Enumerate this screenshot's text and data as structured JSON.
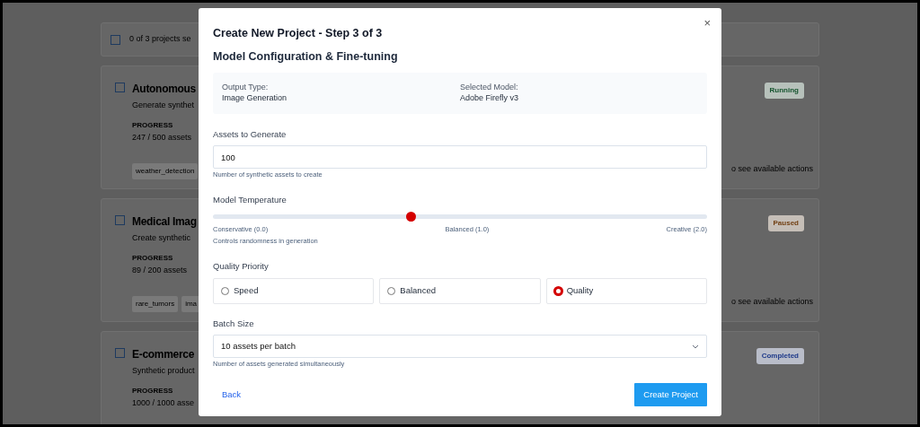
{
  "background": {
    "selection_bar": {
      "checked": false,
      "text": "0 of 3 projects se"
    },
    "projects": [
      {
        "checked": false,
        "title": "Autonomous",
        "description": "Generate synthet",
        "progress_label": "PROGRESS",
        "progress": "247 / 500 assets",
        "tags": [
          "weather_detection"
        ],
        "status": "Running",
        "color": "#14532d",
        "actions_hint": "o see available actions"
      },
      {
        "checked": false,
        "title": "Medical Imag",
        "description": "Create synthetic",
        "progress_label": "PROGRESS",
        "progress": "89 / 200 assets",
        "tags": [
          "rare_tumors",
          "ima"
        ],
        "status": "Paused",
        "color": "#713f12",
        "actions_hint": "o see available actions"
      },
      {
        "checked": false,
        "title": "E-commerce",
        "description": "Synthetic product",
        "progress_label": "PROGRESS",
        "progress": "1000 / 1000 asse",
        "status": "Completed",
        "color": "#1e3a8a"
      }
    ]
  },
  "modal": {
    "title": "Create New Project - Step 3 of 3",
    "close": "×",
    "subtitle": "Model Configuration & Fine-tuning",
    "summary": [
      {
        "label": "Output Type:",
        "value": "Image Generation"
      },
      {
        "label": "Selected Model:",
        "value": "Adobe Firefly v3"
      }
    ],
    "assets": {
      "label": "Assets to Generate",
      "value": "100",
      "help": "Number of synthetic assets to create"
    },
    "temperature": {
      "label": "Model Temperature",
      "level": 0.4,
      "marks": [
        "Conservative (0.0)",
        "Balanced (1.0)",
        "Creative (2.0)"
      ],
      "help": "Controls randomness in generation"
    },
    "quality": {
      "label": "Quality Priority",
      "options": [
        {
          "label": "Speed",
          "selected": false
        },
        {
          "label": "Balanced",
          "selected": false
        },
        {
          "label": "Quality",
          "selected": true
        }
      ]
    },
    "batch": {
      "label": "Batch Size",
      "value": "10 assets per batch",
      "help": "Number of assets generated simultaneously"
    },
    "back": "Back",
    "submit": "Create Project"
  }
}
